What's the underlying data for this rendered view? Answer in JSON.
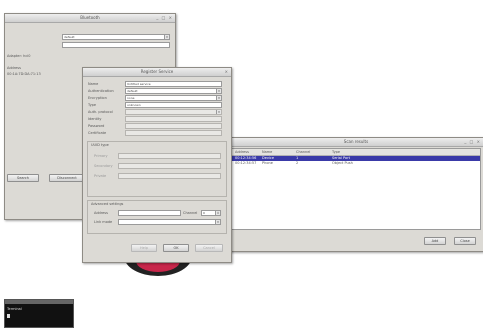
{
  "back_window": {
    "title": "Bluetooth",
    "field_values": [
      "default",
      ""
    ],
    "left_label": "Adapter: hci0",
    "info_label": "Address",
    "info_value": "00:1A:7D:DA:71:13",
    "buttons": [
      "Search",
      "Disconnect"
    ]
  },
  "dialog": {
    "title": "Register Service",
    "fields": [
      {
        "label": "Name",
        "value": "Untitled service",
        "kind": "text"
      },
      {
        "label": "Authentication",
        "value": "default",
        "kind": "combo"
      },
      {
        "label": "Encryption",
        "value": "none",
        "kind": "combo"
      },
      {
        "label": "Type",
        "value": "unknown",
        "kind": "text"
      },
      {
        "label": "Auth. protocol",
        "value": "",
        "kind": "combo"
      },
      {
        "label": "Identity",
        "value": "",
        "kind": "text"
      },
      {
        "label": "Password",
        "value": "",
        "kind": "text"
      },
      {
        "label": "Certificate",
        "value": "",
        "kind": "text"
      }
    ],
    "group1": {
      "title": "UUID type",
      "rows": [
        {
          "label": "Primary",
          "value": ""
        },
        {
          "label": "Secondary",
          "value": ""
        },
        {
          "label": "Private",
          "value": ""
        }
      ]
    },
    "group2": {
      "title": "Advanced settings",
      "row1_label": "Address",
      "row1_right_label": "Channel",
      "row1_right_value": "0",
      "row2_label": "Link mode"
    },
    "buttons": {
      "help": "Help",
      "ok": "OK",
      "cancel": "Cancel"
    }
  },
  "results_window": {
    "title": "Scan results",
    "columns": [
      "Address",
      "Name",
      "Channel",
      "Type"
    ],
    "rows": [
      {
        "c1": "00:12:34:56",
        "c2": "Device",
        "c3": "1",
        "c4": "Serial Port"
      },
      {
        "c1": "00:12:34:57",
        "c2": "Phone",
        "c3": "2",
        "c4": "Object Push"
      }
    ],
    "buttons": {
      "add": "Add",
      "close": "Close"
    }
  },
  "terminal": {
    "line": "Terminal"
  },
  "colors": {
    "selection": "#3a3aa8",
    "disc": "#c8264a"
  }
}
